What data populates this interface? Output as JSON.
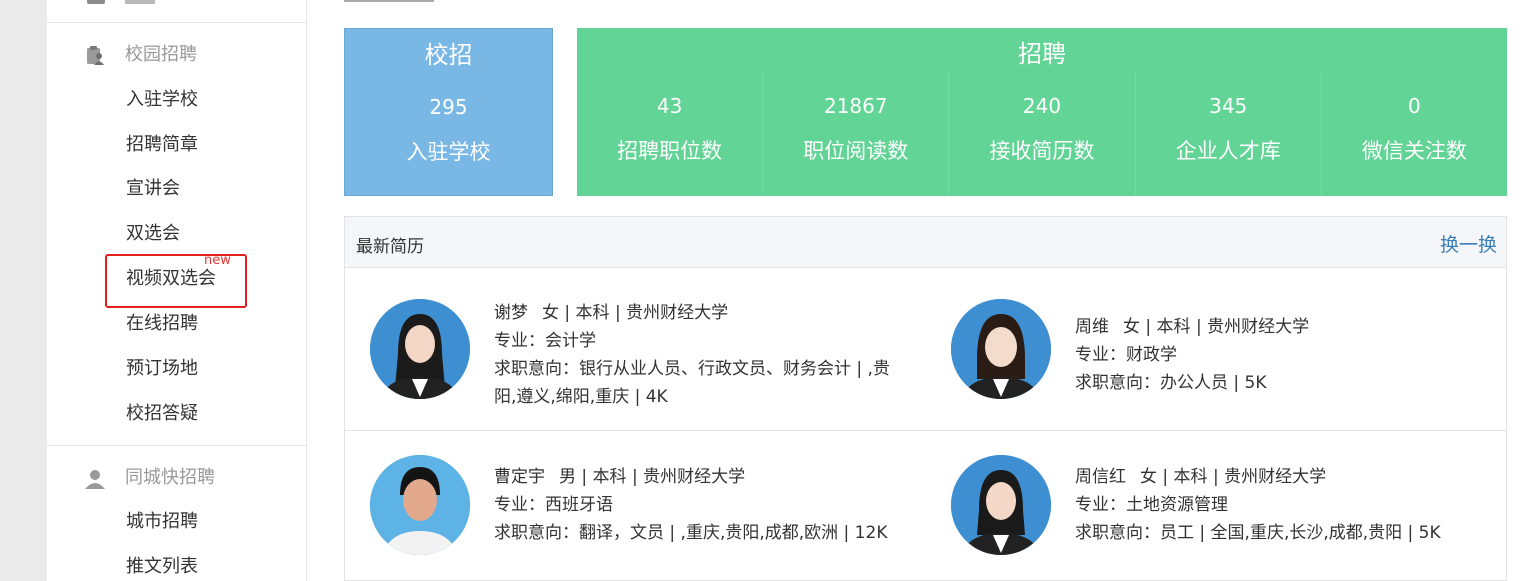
{
  "sidebar": {
    "groups": [
      {
        "label": "校园招聘",
        "icon": "clipboard-user-icon",
        "items": [
          "入驻学校",
          "招聘简章",
          "宣讲会",
          "双选会",
          "视频双选会",
          "在线招聘",
          "预订场地",
          "校招答疑"
        ]
      },
      {
        "label": "同城快招聘",
        "icon": "user-icon",
        "items": [
          "城市招聘",
          "推文列表"
        ]
      }
    ],
    "new_badge": "new"
  },
  "stats": {
    "campus": {
      "title": "校招",
      "value": "295",
      "label": "入驻学校",
      "color": "#79b7e4"
    },
    "recruit": {
      "title": "招聘",
      "color": "#61d496",
      "items": [
        {
          "value": "43",
          "label": "招聘职位数"
        },
        {
          "value": "21867",
          "label": "职位阅读数"
        },
        {
          "value": "240",
          "label": "接收简历数"
        },
        {
          "value": "345",
          "label": "企业人才库"
        },
        {
          "value": "0",
          "label": "微信关注数"
        }
      ]
    }
  },
  "resumes": {
    "title": "最新简历",
    "refresh_label": "换一换",
    "people": [
      {
        "name": "谢梦",
        "meta": "女 | 本科 | 贵州财经大学",
        "major": "专业：会计学",
        "intent": "求职意向：银行从业人员、行政文员、财务会计 | ,贵阳,遵义,绵阳,重庆 | 4K"
      },
      {
        "name": "周维",
        "meta": "女 | 本科 | 贵州财经大学",
        "major": "专业：财政学",
        "intent": "求职意向：办公人员 | 5K"
      },
      {
        "name": "曹定宇",
        "meta": "男 | 本科 | 贵州财经大学",
        "major": "专业：西班牙语",
        "intent": "求职意向：翻译，文员 | ,重庆,贵阳,成都,欧洲 | 12K"
      },
      {
        "name": "周信红",
        "meta": "女 | 本科 | 贵州财经大学",
        "major": "专业：土地资源管理",
        "intent": "求职意向：员工 | 全国,重庆,长沙,成都,贵阳 | 5K"
      }
    ]
  }
}
